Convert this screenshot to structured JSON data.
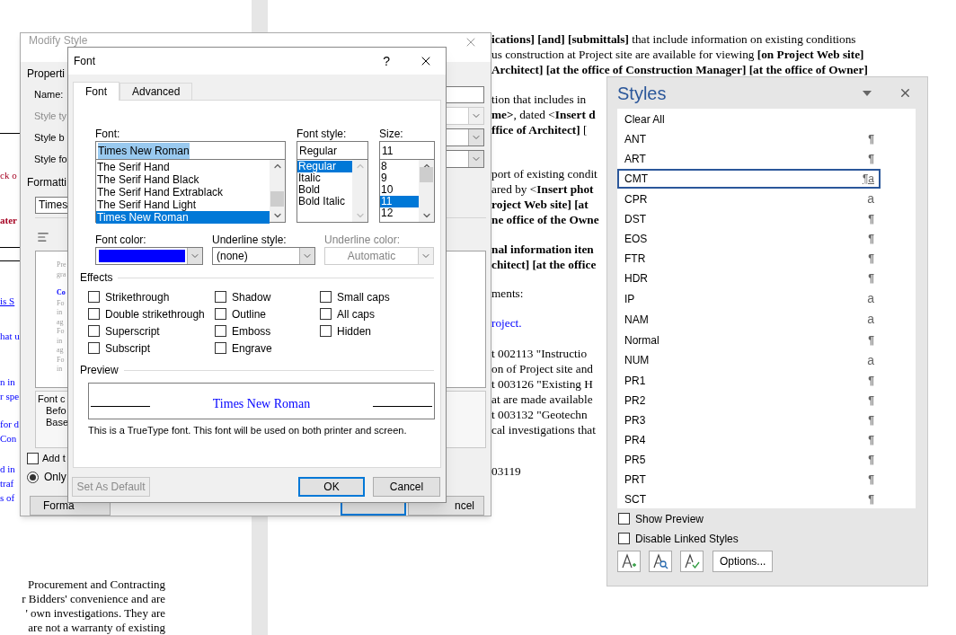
{
  "document": {
    "left_paragraphs": [
      {
        "kind": "red",
        "lines": [
          {
            "text": "ck o",
            "bold": false
          }
        ]
      },
      {
        "kind": "red",
        "lines": [
          {
            "text": "ater",
            "bold": true
          }
        ]
      },
      {
        "kind": "link",
        "lines": [
          {
            "text": "is S",
            "bold": false
          }
        ]
      },
      {
        "kind": "blue",
        "lines": [
          {
            "text": "hat u",
            "bold": false
          }
        ]
      },
      {
        "kind": "blue",
        "lines": [
          {
            "text": "n in",
            "bold": false
          },
          {
            "text": "r spe",
            "bold": false
          }
        ]
      },
      {
        "kind": "blue",
        "lines": [
          {
            "text": "for d",
            "bold": false
          },
          {
            "text": "Con",
            "bold": false
          }
        ]
      },
      {
        "kind": "blue",
        "lines": [
          {
            "text": "d in",
            "bold": false
          },
          {
            "text": "traf",
            "bold": false
          },
          {
            "text": "s of",
            "bold": false
          }
        ]
      },
      {
        "kind": "plain",
        "lines": [
          {
            "text": "Procurement and Contracting",
            "bold": false
          },
          {
            "text": "r Bidders' convenience and are",
            "bold": false
          },
          {
            "text": "' own investigations. They are",
            "bold": false
          },
          {
            "text": "are not a warranty of existing",
            "bold": false
          }
        ]
      }
    ],
    "right_paragraphs": [
      {
        "kind": "plain",
        "lines": [
          {
            "text": "**ications] [and] [submittals]** that include information on existing conditions",
            "bold": false
          },
          {
            "text": "us construction at Project site are available for viewing **[on Project Web site]**",
            "bold": false
          },
          {
            "text": "Architect] [at the office of Construction Manager] [at the office of Owner]",
            "bold": true
          }
        ]
      },
      {
        "kind": "plain",
        "lines": [
          {
            "text": "tion that includes in",
            "bold": false
          },
          {
            "text": "**me>**, dated <**Insert d**",
            "bold": false
          },
          {
            "text": "**ffice of Architect]** [",
            "bold": false
          }
        ]
      },
      {
        "kind": "plain",
        "lines": [
          {
            "text": "port of existing condit",
            "bold": false
          },
          {
            "text": "ared by <**Insert phot**",
            "bold": false
          },
          {
            "text": "roject Web site] [at",
            "bold": true
          },
          {
            "text": "ne office of the Owne",
            "bold": true
          }
        ]
      },
      {
        "kind": "plain",
        "lines": [
          {
            "text": "nal information iten",
            "bold": true
          },
          {
            "text": "chitect] [at the office",
            "bold": true
          }
        ]
      },
      {
        "kind": "plain",
        "lines": [
          {
            "text": "ments:",
            "bold": false
          }
        ]
      },
      {
        "kind": "blue",
        "lines": [
          {
            "text": "roject.",
            "bold": false
          }
        ]
      },
      {
        "kind": "plain",
        "lines": [
          {
            "text": "t 002113   \"Instructio",
            "bold": false
          },
          {
            "text": "on of Project site and",
            "bold": false
          },
          {
            "text": "t 003126 \"Existing H",
            "bold": false
          },
          {
            "text": "at are made available",
            "bold": false
          },
          {
            "text": "t 003132   \"Geotechn",
            "bold": false
          },
          {
            "text": "cal investigations that",
            "bold": false
          }
        ]
      },
      {
        "kind": "plain",
        "lines": [
          {
            "text": "03119",
            "bold": false
          }
        ]
      }
    ]
  },
  "modify_style": {
    "title": "Modify Style",
    "properties_heading": "Properti",
    "fields": [
      {
        "label": "Name:",
        "kind": "input",
        "disabled": false
      },
      {
        "label": "Style ty",
        "kind": "combo",
        "disabled": true
      },
      {
        "label": "Style b",
        "kind": "combo",
        "disabled": false
      },
      {
        "label": "Style fo",
        "kind": "combo",
        "disabled": false
      }
    ],
    "formatting_heading": "Formatti",
    "font_combo": "Times",
    "preview_lines": [
      {
        "text": "Pre",
        "kind": "previous"
      },
      {
        "text": "gra",
        "kind": "previous"
      },
      {
        "text": "Co",
        "kind": "current"
      },
      {
        "text": "Fo",
        "kind": "following"
      },
      {
        "text": "in",
        "kind": "following"
      },
      {
        "text": "ag",
        "kind": "following"
      },
      {
        "text": "Fo",
        "kind": "following"
      },
      {
        "text": "in",
        "kind": "following"
      },
      {
        "text": "ag",
        "kind": "following"
      },
      {
        "text": "Fo",
        "kind": "following"
      },
      {
        "text": "in",
        "kind": "following"
      }
    ],
    "description_lines": [
      "Font c",
      "Befo",
      "Base"
    ],
    "add_checkbox": {
      "label": "Add t",
      "checked": false
    },
    "only_radio": {
      "label": "Only",
      "selected": true
    },
    "format_button": "Forma",
    "cancel_button": "ncel"
  },
  "font_dialog": {
    "title": "Font",
    "help": "?",
    "tabs": [
      {
        "label": "Font",
        "selected": true
      },
      {
        "label": "Advanced",
        "selected": false
      }
    ],
    "font": {
      "label": "Font:",
      "value": "Times New Roman",
      "text_selected": true,
      "options": [
        {
          "label": "The Serif Hand",
          "selected": false
        },
        {
          "label": "The Serif Hand Black",
          "selected": false
        },
        {
          "label": "The Serif Hand Extrablack",
          "selected": false
        },
        {
          "label": "The Serif Hand Light",
          "selected": false
        },
        {
          "label": "Times New Roman",
          "selected": true
        }
      ]
    },
    "font_style": {
      "label": "Font style:",
      "value": "Regular",
      "options": [
        {
          "label": "Regular",
          "selected": true
        },
        {
          "label": "Italic",
          "selected": false
        },
        {
          "label": "Bold",
          "selected": false
        },
        {
          "label": "Bold Italic",
          "selected": false
        }
      ]
    },
    "size": {
      "label": "Size:",
      "value": "11",
      "options": [
        {
          "label": "8",
          "selected": false
        },
        {
          "label": "9",
          "selected": false
        },
        {
          "label": "10",
          "selected": false
        },
        {
          "label": "11",
          "selected": true
        },
        {
          "label": "12",
          "selected": false
        }
      ]
    },
    "font_color": {
      "label": "Font color:",
      "color": "#0000ff"
    },
    "underline_style": {
      "label": "Underline style:",
      "value": "(none)",
      "disabled": false
    },
    "underline_color": {
      "label": "Underline color:",
      "value": "Automatic",
      "disabled": true
    },
    "effects_heading": "Effects",
    "effect_columns": [
      [
        {
          "label": "Strikethrough",
          "checked": false
        },
        {
          "label": "Double strikethrough",
          "checked": false
        },
        {
          "label": "Superscript",
          "checked": false
        },
        {
          "label": "Subscript",
          "checked": false
        }
      ],
      [
        {
          "label": "Shadow",
          "checked": false
        },
        {
          "label": "Outline",
          "checked": false
        },
        {
          "label": "Emboss",
          "checked": false
        },
        {
          "label": "Engrave",
          "checked": false
        }
      ],
      [
        {
          "label": "Small caps",
          "checked": false
        },
        {
          "label": "All caps",
          "checked": false
        },
        {
          "label": "Hidden",
          "checked": false
        }
      ]
    ],
    "preview_heading": "Preview",
    "preview_text": "Times New Roman",
    "note": "This is a TrueType font. This font will be used on both printer and screen.",
    "buttons": [
      {
        "label": "Set As Default",
        "disabled": true,
        "default": false
      },
      {
        "label": "OK",
        "disabled": false,
        "default": true
      },
      {
        "label": "Cancel",
        "disabled": false,
        "default": false
      }
    ]
  },
  "styles_pane": {
    "title": "Styles",
    "items": [
      {
        "name": "Clear All",
        "kind": "none",
        "selected": false
      },
      {
        "name": "ANT",
        "kind": "paragraph",
        "symbol": "¶",
        "selected": false
      },
      {
        "name": "ART",
        "kind": "paragraph",
        "symbol": "¶",
        "selected": false
      },
      {
        "name": "CMT",
        "kind": "linked",
        "symbol": "¶a",
        "selected": true
      },
      {
        "name": "CPR",
        "kind": "character",
        "symbol": "a",
        "selected": false
      },
      {
        "name": "DST",
        "kind": "paragraph",
        "symbol": "¶",
        "selected": false
      },
      {
        "name": "EOS",
        "kind": "paragraph",
        "symbol": "¶",
        "selected": false
      },
      {
        "name": "FTR",
        "kind": "paragraph",
        "symbol": "¶",
        "selected": false
      },
      {
        "name": "HDR",
        "kind": "paragraph",
        "symbol": "¶",
        "selected": false
      },
      {
        "name": "IP",
        "kind": "character",
        "symbol": "a",
        "selected": false
      },
      {
        "name": "NAM",
        "kind": "character",
        "symbol": "a",
        "selected": false
      },
      {
        "name": "Normal",
        "kind": "paragraph",
        "symbol": "¶",
        "selected": false
      },
      {
        "name": "NUM",
        "kind": "character",
        "symbol": "a",
        "selected": false
      },
      {
        "name": "PR1",
        "kind": "paragraph",
        "symbol": "¶",
        "selected": false
      },
      {
        "name": "PR2",
        "kind": "paragraph",
        "symbol": "¶",
        "selected": false
      },
      {
        "name": "PR3",
        "kind": "paragraph",
        "symbol": "¶",
        "selected": false
      },
      {
        "name": "PR4",
        "kind": "paragraph",
        "symbol": "¶",
        "selected": false
      },
      {
        "name": "PR5",
        "kind": "paragraph",
        "symbol": "¶",
        "selected": false
      },
      {
        "name": "PRT",
        "kind": "paragraph",
        "symbol": "¶",
        "selected": false
      },
      {
        "name": "SCT",
        "kind": "paragraph",
        "symbol": "¶",
        "selected": false
      }
    ],
    "show_preview": {
      "label": "Show Preview",
      "checked": false
    },
    "disable_linked": {
      "label": "Disable Linked Styles",
      "checked": false
    },
    "options_button": "Options..."
  }
}
